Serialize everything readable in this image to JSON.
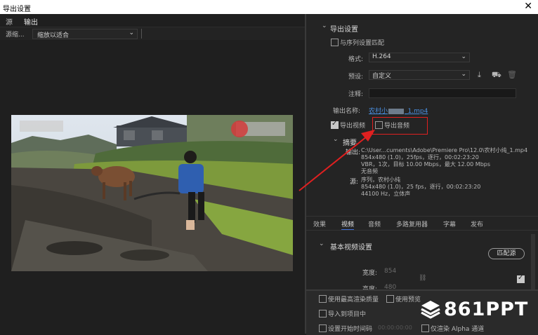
{
  "window": {
    "title": "导出设置",
    "close_glyph": "✕"
  },
  "left_panel": {
    "tabs": [
      {
        "label": "源"
      },
      {
        "label": "输出"
      }
    ],
    "source_scaling_label": "源缩...",
    "source_scaling_value": "缩放以适合"
  },
  "right_panel": {
    "export_settings_header": "导出设置",
    "match_sequence_label": "与序列设置匹配",
    "format_label": "格式:",
    "format_value": "H.264",
    "preset_label": "预设:",
    "preset_value": "自定义",
    "comment_label": "注释:",
    "output_name_label": "输出名称:",
    "output_name_value_prefix": "农村小",
    "output_name_value_suffix": "_1.mp4",
    "export_video_label": "导出视频",
    "export_video_checked": true,
    "export_audio_label": "导出音频",
    "export_audio_checked": false,
    "summary_header": "摘要",
    "summary_output_label": "输出:",
    "summary_output_lines": [
      "C:\\User...cuments\\Adobe\\Premiere Pro\\12.0\\农村小纯_1.mp4",
      "854x480 (1.0)，25fps，逐行，00:02:23:20",
      "VBR，1次，目标 10.00 Mbps，最大 12.00 Mbps",
      "无音频"
    ],
    "summary_source_label": "源:",
    "summary_source_lines": [
      "序列，农村小纯",
      "854x480 (1.0)，25 fps，逐行，00:02:23:20",
      "44100 Hz，立体声"
    ],
    "sub_tabs": [
      {
        "label": "效果"
      },
      {
        "label": "视频"
      },
      {
        "label": "音频"
      },
      {
        "label": "多路复用器"
      },
      {
        "label": "字幕"
      },
      {
        "label": "发布"
      }
    ],
    "basic_video_header": "基本视频设置",
    "match_source_button": "匹配源",
    "width_label": "宽度:",
    "width_value": "854",
    "height_label": "高度:",
    "height_value": "480"
  },
  "bottom_panel": {
    "max_render_quality": "使用最高渲染质量",
    "use_previews": "使用预览",
    "import_into_project": "导入到项目中",
    "set_start_timecode": "设置开始时间码",
    "start_timecode_value": "00:00:00:00",
    "render_alpha_only": "仅渲染 Alpha 通道"
  },
  "watermark": {
    "text": "861PPT"
  },
  "colors": {
    "accent": "#3f6fd8",
    "highlight": "#e02020",
    "link": "#4a8fe0"
  }
}
